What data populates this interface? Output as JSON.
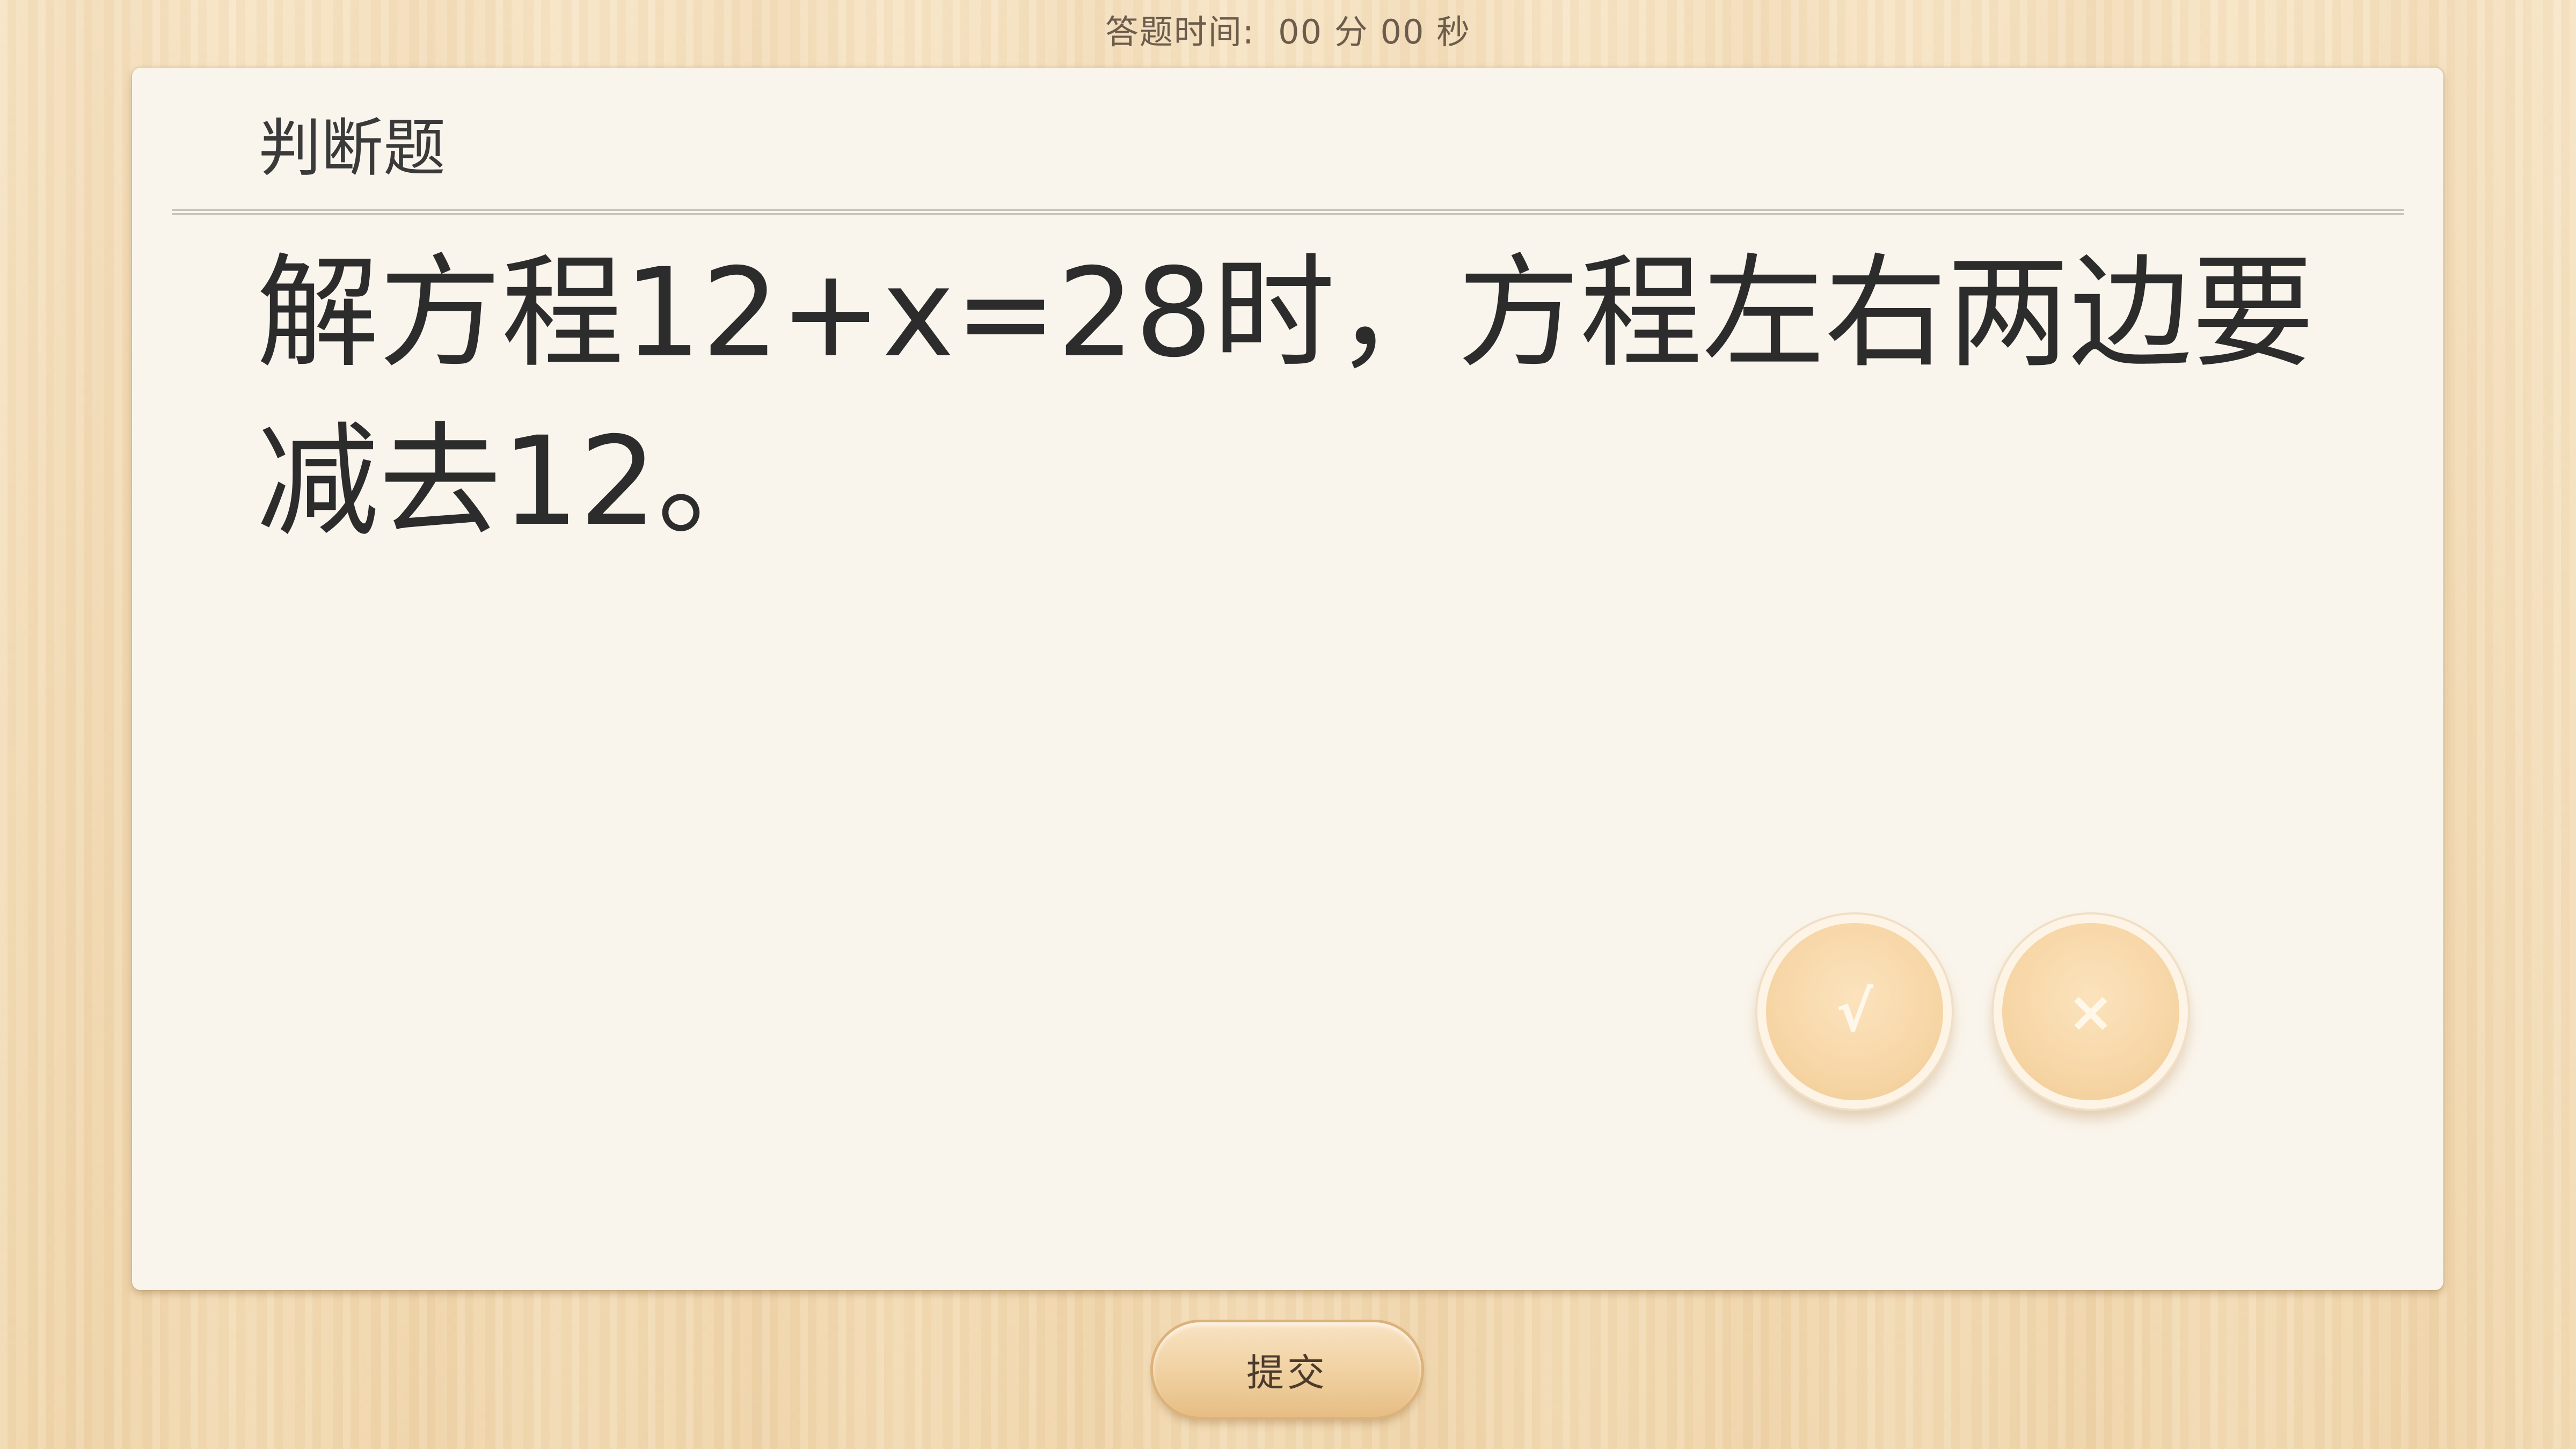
{
  "timer": {
    "label": "答题时间:",
    "minutes": "00",
    "minutes_unit": "分",
    "seconds": "00",
    "seconds_unit": "秒"
  },
  "question": {
    "type_label": "判断题",
    "text": "解方程12+x=28时，方程左右两边要减去12。"
  },
  "answers": {
    "true_label": "√",
    "false_label": "×"
  },
  "footer": {
    "submit_label": "提交"
  },
  "colors": {
    "wood_background": "#f3dcb6",
    "card_background": "#faf5ec",
    "answer_button": "#f7d6a6",
    "text": "#2c2c2c"
  }
}
